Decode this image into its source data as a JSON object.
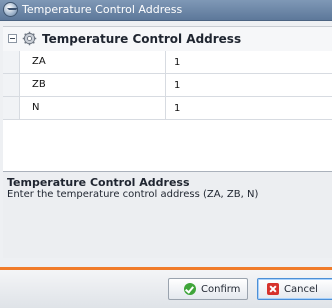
{
  "window": {
    "title": "Temperature Control Address"
  },
  "group": {
    "title": "Temperature Control Address",
    "icon": "gear-icon"
  },
  "properties": [
    {
      "name": "ZA",
      "value": "1"
    },
    {
      "name": "ZB",
      "value": "1"
    },
    {
      "name": "N",
      "value": "1"
    }
  ],
  "description": {
    "title": "Temperature Control Address",
    "text": "Enter the temperature control address (ZA, ZB, N)"
  },
  "buttons": {
    "confirm_label": "Confirm",
    "cancel_label": "Cancel"
  },
  "colors": {
    "accent": "#f07b2a",
    "titlebar": "#6e88aa",
    "confirm_icon": "#3fa53a",
    "cancel_icon": "#d6312b"
  }
}
